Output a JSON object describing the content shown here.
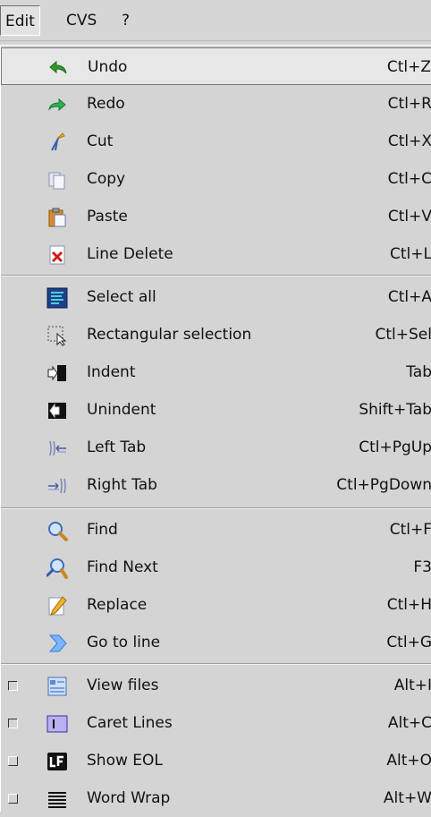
{
  "menubar": {
    "edit": "Edit",
    "cvs": "CVS",
    "help": "?"
  },
  "menu": {
    "undo": {
      "label": "Undo",
      "shortcut": "Ctl+Z"
    },
    "redo": {
      "label": "Redo",
      "shortcut": "Ctl+R"
    },
    "cut": {
      "label": "Cut",
      "shortcut": "Ctl+X"
    },
    "copy": {
      "label": "Copy",
      "shortcut": "Ctl+C"
    },
    "paste": {
      "label": "Paste",
      "shortcut": "Ctl+V"
    },
    "line_delete": {
      "label": "Line Delete",
      "shortcut": "Ctl+L"
    },
    "select_all": {
      "label": "Select all",
      "shortcut": "Ctl+A"
    },
    "rect_sel": {
      "label": "Rectangular selection",
      "shortcut": "Ctl+Sel"
    },
    "indent": {
      "label": "Indent",
      "shortcut": "Tab"
    },
    "unindent": {
      "label": "Unindent",
      "shortcut": "Shift+Tab"
    },
    "left_tab": {
      "label": "Left Tab",
      "shortcut": "Ctl+PgUp"
    },
    "right_tab": {
      "label": "Right Tab",
      "shortcut": "Ctl+PgDown"
    },
    "find": {
      "label": "Find",
      "shortcut": "Ctl+F"
    },
    "find_next": {
      "label": "Find Next",
      "shortcut": "F3"
    },
    "replace": {
      "label": "Replace",
      "shortcut": "Ctl+H"
    },
    "goto_line": {
      "label": "Go to line",
      "shortcut": "Ctl+G"
    },
    "view_files": {
      "label": "View files",
      "shortcut": "Alt+I"
    },
    "caret_lines": {
      "label": "Caret Lines",
      "shortcut": "Alt+C"
    },
    "show_eol": {
      "label": "Show EOL",
      "shortcut": "Alt+O"
    },
    "word_wrap": {
      "label": "Word Wrap",
      "shortcut": "Alt+W"
    }
  },
  "icons": {
    "undo": "undo-arrow-icon",
    "redo": "redo-arrow-icon",
    "cut": "scissors-icon",
    "copy": "copy-pages-icon",
    "paste": "clipboard-icon",
    "line_delete": "red-x-document-icon",
    "select_all": "select-all-icon",
    "rect_sel": "rectangle-selection-icon",
    "indent": "indent-icon",
    "unindent": "unindent-icon",
    "left_tab": "left-tab-icon",
    "right_tab": "right-tab-icon",
    "find": "magnifier-icon",
    "find_next": "magnifier-next-icon",
    "replace": "pencil-replace-icon",
    "goto_line": "chevron-right-icon",
    "view_files": "file-list-icon",
    "caret_lines": "caret-lines-icon",
    "show_eol": "lf-eol-icon",
    "word_wrap": "word-wrap-lines-icon"
  },
  "toggles": {
    "view_files": "unchecked",
    "caret_lines": "unchecked",
    "show_eol": "unchecked",
    "word_wrap": "unchecked"
  },
  "colors": {
    "menu_bg": "#d4d4d4",
    "highlight_bg": "#e7e7e7",
    "text": "#111111"
  }
}
